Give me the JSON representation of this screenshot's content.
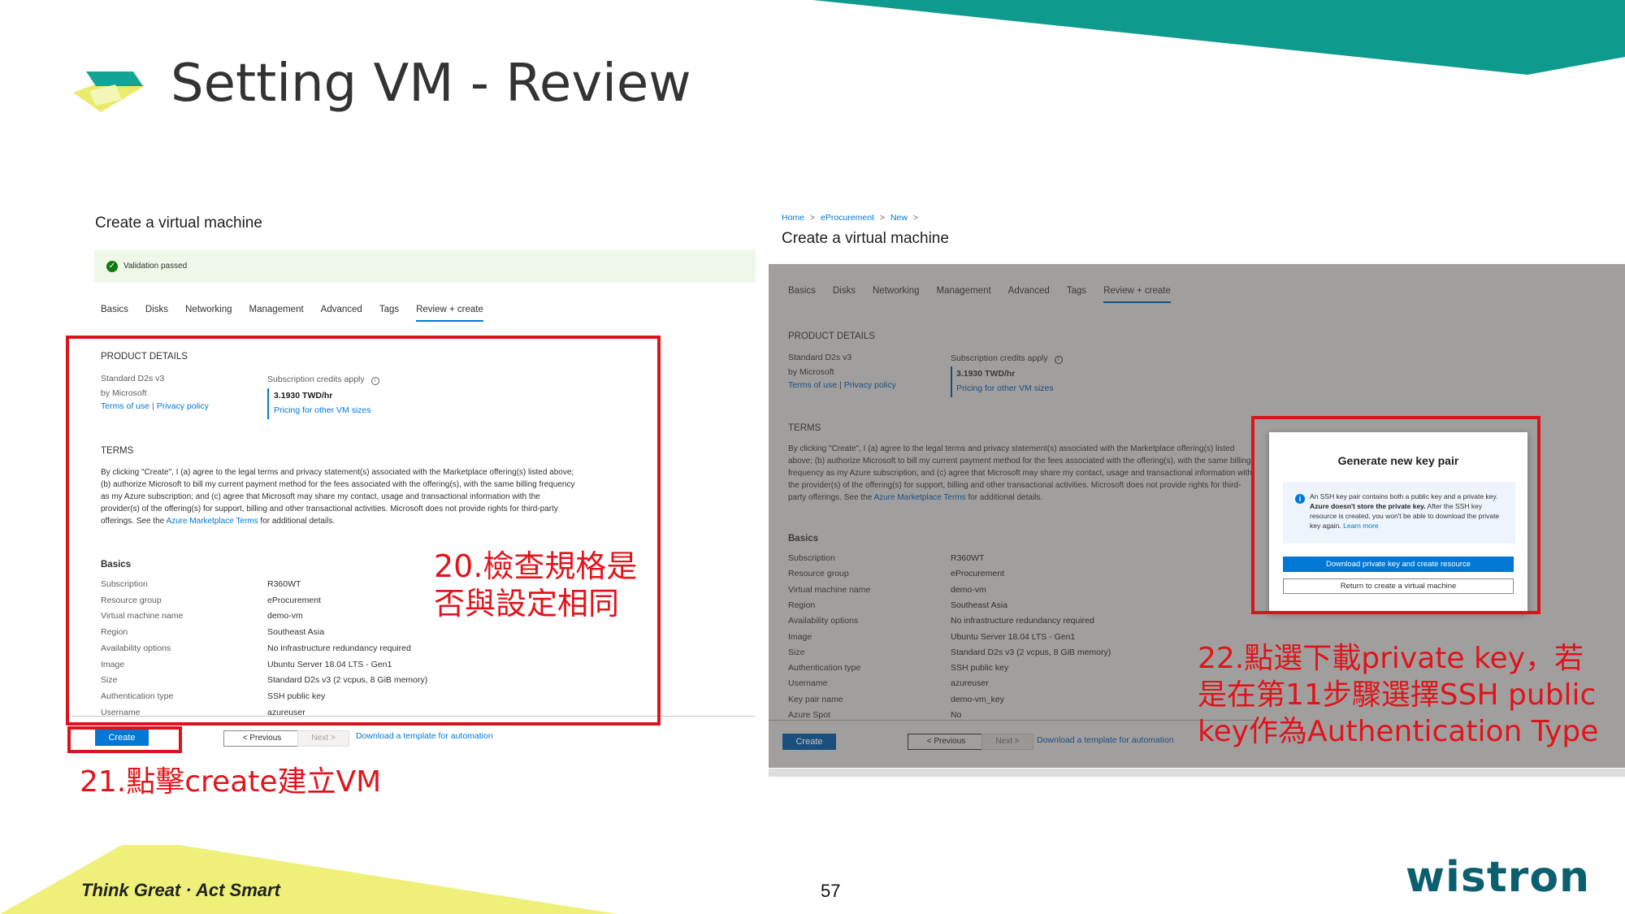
{
  "slide": {
    "title": "Setting VM - Review",
    "footer_slogan": "Think Great · Act Smart",
    "page_number": "57",
    "brand": "wistron"
  },
  "left": {
    "heading": "Create a virtual machine",
    "validation": "Validation passed",
    "tabs": [
      "Basics",
      "Disks",
      "Networking",
      "Management",
      "Advanced",
      "Tags",
      "Review + create"
    ],
    "active_tab": "Review + create",
    "product_details_head": "PRODUCT DETAILS",
    "product_name": "Standard D2s v3",
    "product_by": "by Microsoft",
    "terms_of_use": "Terms of use",
    "privacy_policy": "Privacy policy",
    "sep": "|",
    "credits_label": "Subscription credits apply",
    "price": "3.1930 TWD/hr",
    "pricing_link": "Pricing for other VM sizes",
    "terms_head": "TERMS",
    "terms_text": "By clicking \"Create\", I (a) agree to the legal terms and privacy statement(s) associated with the Marketplace offering(s) listed above; (b) authorize Microsoft to bill my current payment method for the fees associated with the offering(s), with the same billing frequency as my Azure subscription; and (c) agree that Microsoft may share my contact, usage and transactional information with the provider(s) of the offering(s) for support, billing and other transactional activities. Microsoft does not provide rights for third-party offerings. See the",
    "terms_link": "Azure Marketplace Terms",
    "terms_tail": "for additional details.",
    "basics_head": "Basics",
    "basics": [
      {
        "label": "Subscription",
        "value": "R360WT"
      },
      {
        "label": "Resource group",
        "value": "eProcurement"
      },
      {
        "label": "Virtual machine name",
        "value": "demo-vm"
      },
      {
        "label": "Region",
        "value": "Southeast Asia"
      },
      {
        "label": "Availability options",
        "value": "No infrastructure redundancy required"
      },
      {
        "label": "Image",
        "value": "Ubuntu Server 18.04 LTS - Gen1"
      },
      {
        "label": "Size",
        "value": "Standard D2s v3 (2 vcpus, 8 GiB memory)"
      },
      {
        "label": "Authentication type",
        "value": "SSH public key"
      },
      {
        "label": "Username",
        "value": "azureuser"
      }
    ],
    "create_btn": "Create",
    "prev_btn": "< Previous",
    "next_btn": "Next >",
    "download_link": "Download a template for automation",
    "note20": [
      "20.檢查規格是",
      "否與設定相同"
    ],
    "note21": "21.點擊create建立VM"
  },
  "right": {
    "breadcrumb": [
      "Home",
      "eProcurement",
      "New"
    ],
    "breadcrumb_sep": ">",
    "heading": "Create a virtual machine",
    "tabs": [
      "Basics",
      "Disks",
      "Networking",
      "Management",
      "Advanced",
      "Tags",
      "Review + create"
    ],
    "product_details_head": "PRODUCT DETAILS",
    "product_name": "Standard D2s v3",
    "product_by": "by Microsoft",
    "terms_of_use": "Terms of use",
    "privacy_policy": "Privacy policy",
    "sep": "|",
    "credits_label": "Subscription credits apply",
    "price": "3.1930 TWD/hr",
    "pricing_link": "Pricing for other VM sizes",
    "terms_head": "TERMS",
    "terms_text": "By clicking \"Create\", I (a) agree to the legal terms and privacy statement(s) associated with the Marketplace offering(s) listed above; (b) authorize Microsoft to bill my current payment method for the fees associated with the offering(s), with the same billing frequency as my Azure subscription; and (c) agree that Microsoft may share my contact, usage and transactional information with the provider(s) of the offering(s) for support, billing and other transactional activities. Microsoft does not provide rights for third-party offerings. See the",
    "terms_link": "Azure Marketplace Terms",
    "terms_tail": "for additional details.",
    "basics_head": "Basics",
    "basics": [
      {
        "label": "Subscription",
        "value": "R360WT"
      },
      {
        "label": "Resource group",
        "value": "eProcurement"
      },
      {
        "label": "Virtual machine name",
        "value": "demo-vm"
      },
      {
        "label": "Region",
        "value": "Southeast Asia"
      },
      {
        "label": "Availability options",
        "value": "No infrastructure redundancy required"
      },
      {
        "label": "Image",
        "value": "Ubuntu Server 18.04 LTS - Gen1"
      },
      {
        "label": "Size",
        "value": "Standard D2s v3 (2 vcpus, 8 GiB memory)"
      },
      {
        "label": "Authentication type",
        "value": "SSH public key"
      },
      {
        "label": "Username",
        "value": "azureuser"
      },
      {
        "label": "Key pair name",
        "value": "demo-vm_key"
      },
      {
        "label": "Azure Spot",
        "value": "No"
      }
    ],
    "create_btn": "Create",
    "prev_btn": "< Previous",
    "next_btn": "Next >",
    "download_link": "Download a template for automation",
    "dialog": {
      "title": "Generate new key pair",
      "info_text": "An SSH key pair contains both a public key and a private key.",
      "info_bold": "Azure doesn't store the private key.",
      "info_tail": "After the SSH key resource is created, you won't be able to download the private key again.",
      "learn_more": "Learn more",
      "primary_btn": "Download private key and create resource",
      "secondary_btn": "Return to create a virtual machine"
    },
    "note22": [
      "22.點選下載private key，若",
      "是在第11步驟選擇SSH public",
      "key作為Authentication Type"
    ]
  },
  "colors": {
    "teal": "#0f9a8e",
    "yellow": "#e9ec6a",
    "accent": "#0078d4",
    "annotation_red": "#d9141c",
    "brand": "#0b5f6e"
  }
}
